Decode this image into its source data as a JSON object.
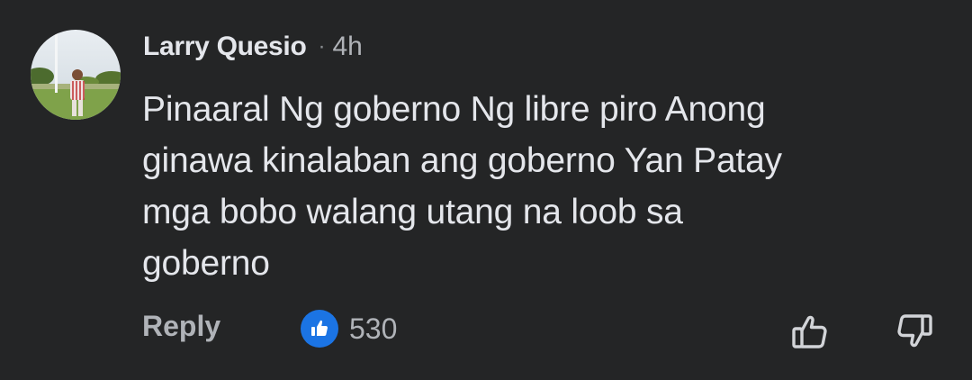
{
  "comment": {
    "author": "Larry Quesio",
    "separator": "·",
    "timestamp": "4h",
    "text": "Pinaaral Ng goberno Ng libre piro Anong\nginawa kinalaban ang goberno Yan Patay\nmga bobo walang utang na loob sa\ngoberno"
  },
  "actions": {
    "reply_label": "Reply",
    "like_count": "530",
    "like_icon": "thumbs-up-icon",
    "upvote_icon": "thumb-up-outline-icon",
    "downvote_icon": "thumb-down-outline-icon"
  },
  "colors": {
    "background": "#242526",
    "primary_text": "#e4e6eb",
    "secondary_text": "#b0b3b8",
    "like_blue": "#1b74e4"
  }
}
